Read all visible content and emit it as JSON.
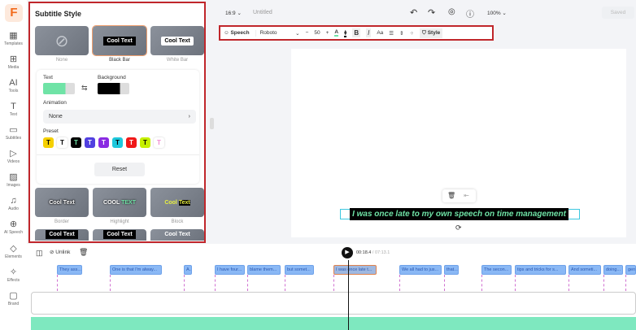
{
  "nav": {
    "items": [
      "Templates",
      "Media",
      "Tools",
      "Text",
      "Subtitles",
      "Videos",
      "Images",
      "Audio",
      "AI Speech",
      "Elements",
      "Effects",
      "Brand"
    ],
    "icons": [
      "▦",
      "⊞",
      "AI",
      "T",
      "▭",
      "▷",
      "▨",
      "♫",
      "⊕",
      "◇",
      "✧",
      "▢"
    ],
    "logo": "F"
  },
  "panel": {
    "title": "Subtitle Style",
    "top_styles": [
      {
        "label": "None",
        "sample": "⊘"
      },
      {
        "label": "Black Bar",
        "sample": "Cool Text"
      },
      {
        "label": "White Bar",
        "sample": "Cool Text"
      }
    ],
    "text_label": "Text",
    "background_label": "Background",
    "text_color": "#6fe3a6",
    "bg_color": "#000000",
    "animation_label": "Animation",
    "animation_value": "None",
    "preset_label": "Preset",
    "presets": [
      {
        "bg": "#f5d000",
        "fg": "#000"
      },
      {
        "bg": "#ffffff",
        "fg": "#000"
      },
      {
        "bg": "#000000",
        "fg": "#6fe3a6"
      },
      {
        "bg": "#5140e0",
        "fg": "#fff"
      },
      {
        "bg": "#8a2be2",
        "fg": "#fff"
      },
      {
        "bg": "#1ec8dc",
        "fg": "#000"
      },
      {
        "bg": "#f01818",
        "fg": "#fff"
      },
      {
        "bg": "#c6f000",
        "fg": "#000"
      },
      {
        "bg": "#ffffff",
        "fg": "#f08ad0"
      }
    ],
    "preset_glyph": "T",
    "reset_label": "Reset",
    "more_styles": [
      {
        "label": "Border",
        "a": "Cool Text",
        "b": ""
      },
      {
        "label": "Highlight",
        "a": "COOL ",
        "b": "TEXT"
      },
      {
        "label": "Block",
        "a": "Cool ",
        "b": "Text"
      }
    ],
    "row3": [
      "Cool Text",
      "Cool Text",
      "Cool Text"
    ]
  },
  "topbar": {
    "ratio": "16:9",
    "title": "Untitled",
    "zoom": "100%",
    "saved": "Saved"
  },
  "toolbar": {
    "speech": "Speech",
    "font": "Roboto",
    "size": "50",
    "minus": "−",
    "plus": "+",
    "style": "Style"
  },
  "canvas": {
    "subtitle": "I was once late to my own speech on time management"
  },
  "timeline": {
    "unlink": "Unlink",
    "current": "00:18.4",
    "total": "07:13.1",
    "clips": [
      "They ass...",
      "One is that I'm alway...",
      "A...",
      "I have four...",
      "blame them...",
      "but somet...",
      "I was once late t...",
      "We all had to jus...",
      "that...",
      "The secon...",
      "tips and tricks for s...",
      "And someti...",
      "doing...",
      "gen"
    ]
  }
}
